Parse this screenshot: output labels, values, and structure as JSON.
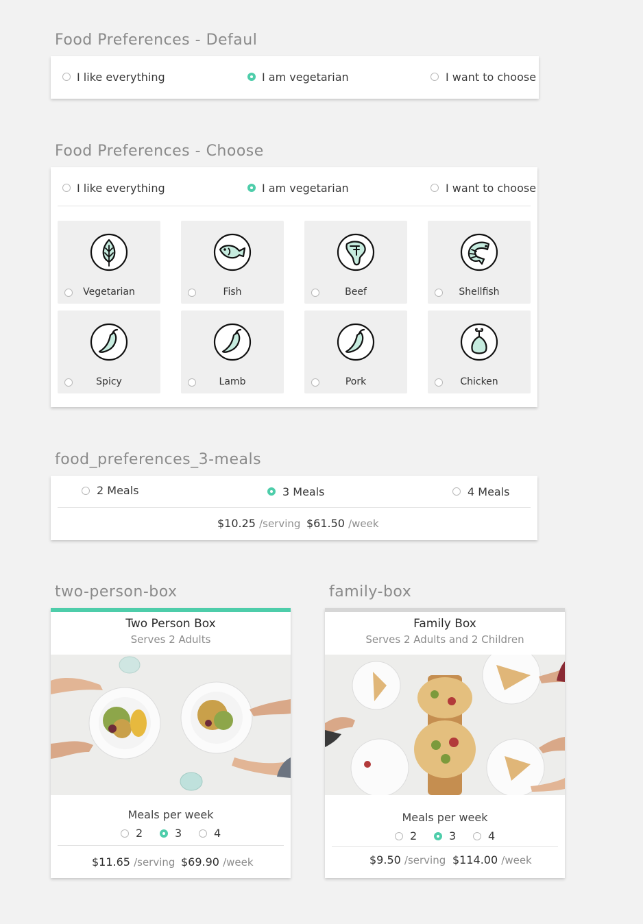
{
  "colors": {
    "accent": "#4ecdaa",
    "background": "#f2f2f2",
    "tile": "#efefef"
  },
  "default_section": {
    "title": "Food Preferences - Defaul",
    "options": [
      {
        "label": "I like everything",
        "selected": false
      },
      {
        "label": "I am vegetarian",
        "selected": true
      },
      {
        "label": "I want to choose",
        "selected": false
      }
    ]
  },
  "choose_section": {
    "title": "Food Preferences - Choose",
    "options": [
      {
        "label": "I like everything",
        "selected": false
      },
      {
        "label": "I am vegetarian",
        "selected": true
      },
      {
        "label": "I want to choose",
        "selected": false
      }
    ],
    "tiles": [
      {
        "label": "Vegetarian",
        "icon": "leaf-icon"
      },
      {
        "label": "Fish",
        "icon": "fish-icon"
      },
      {
        "label": "Beef",
        "icon": "steak-icon"
      },
      {
        "label": "Shellfish",
        "icon": "shrimp-icon"
      },
      {
        "label": "Spicy",
        "icon": "pepper-icon"
      },
      {
        "label": "Lamb",
        "icon": "pepper-icon"
      },
      {
        "label": "Pork",
        "icon": "pepper-icon"
      },
      {
        "label": "Chicken",
        "icon": "chicken-leg-icon"
      }
    ]
  },
  "meals_section": {
    "title": "food_preferences_3-meals",
    "options": [
      {
        "label": "2 Meals",
        "selected": false
      },
      {
        "label": "3 Meals",
        "selected": true
      },
      {
        "label": "4 Meals",
        "selected": false
      }
    ],
    "price_serving": "$10.25",
    "serving_unit": "/serving",
    "price_week": "$61.50",
    "week_unit": "/week"
  },
  "two_person_box": {
    "section_title": "two-person-box",
    "title": "Two Person Box",
    "subtitle": "Serves 2 Adults",
    "meals_label": "Meals per week",
    "meal_options": [
      {
        "label": "2",
        "selected": false
      },
      {
        "label": "3",
        "selected": true
      },
      {
        "label": "4",
        "selected": false
      }
    ],
    "price_serving": "$11.65",
    "serving_unit": "/serving",
    "price_week": "$69.90",
    "week_unit": "/week"
  },
  "family_box": {
    "section_title": "family-box",
    "title": "Family Box",
    "subtitle": "Serves 2  Adults and 2 Children",
    "meals_label": "Meals per week",
    "meal_options": [
      {
        "label": "2",
        "selected": false
      },
      {
        "label": "3",
        "selected": true
      },
      {
        "label": "4",
        "selected": false
      }
    ],
    "price_serving": "$9.50",
    "serving_unit": "/serving",
    "price_week": "$114.00",
    "week_unit": "/week"
  }
}
